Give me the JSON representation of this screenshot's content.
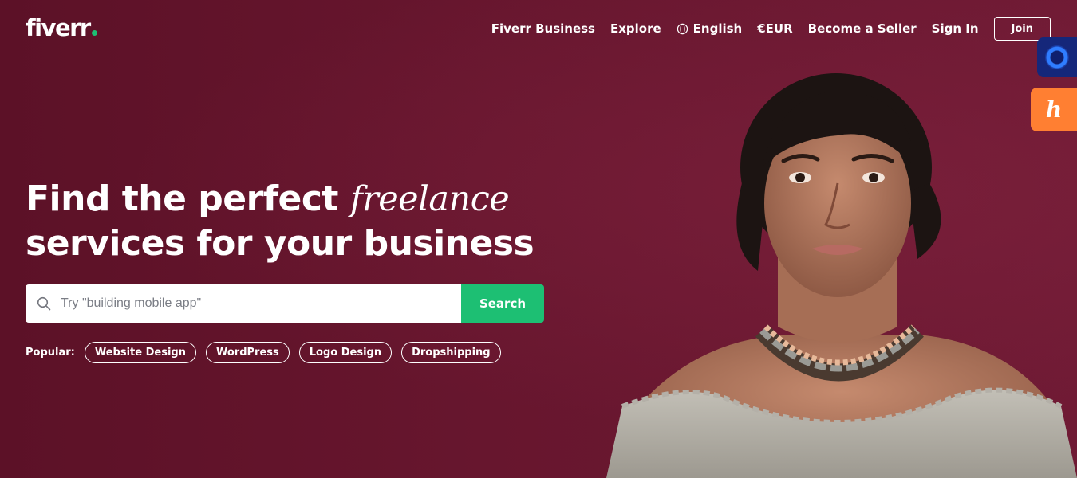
{
  "header": {
    "logo_text": "fiverr",
    "nav": {
      "business": "Fiverr Business",
      "explore": "Explore",
      "language": "English",
      "currency": "€EUR",
      "become_seller": "Become a Seller",
      "sign_in": "Sign In",
      "join": "Join"
    }
  },
  "hero": {
    "headline_line1_prefix": "Find the perfect",
    "headline_accent": "freelance",
    "headline_line2": "services for your business"
  },
  "search": {
    "placeholder": "Try \"building mobile app\"",
    "button_label": "Search"
  },
  "popular": {
    "label": "Popular:",
    "tags": [
      "Website Design",
      "WordPress",
      "Logo Design",
      "Dropshipping"
    ]
  },
  "widgets": {
    "orange_letter": "h"
  },
  "colors": {
    "background": "#5c1127",
    "accent_green": "#1dbf73",
    "widget_blue": "#15277a",
    "widget_orange": "#ff7f32"
  }
}
